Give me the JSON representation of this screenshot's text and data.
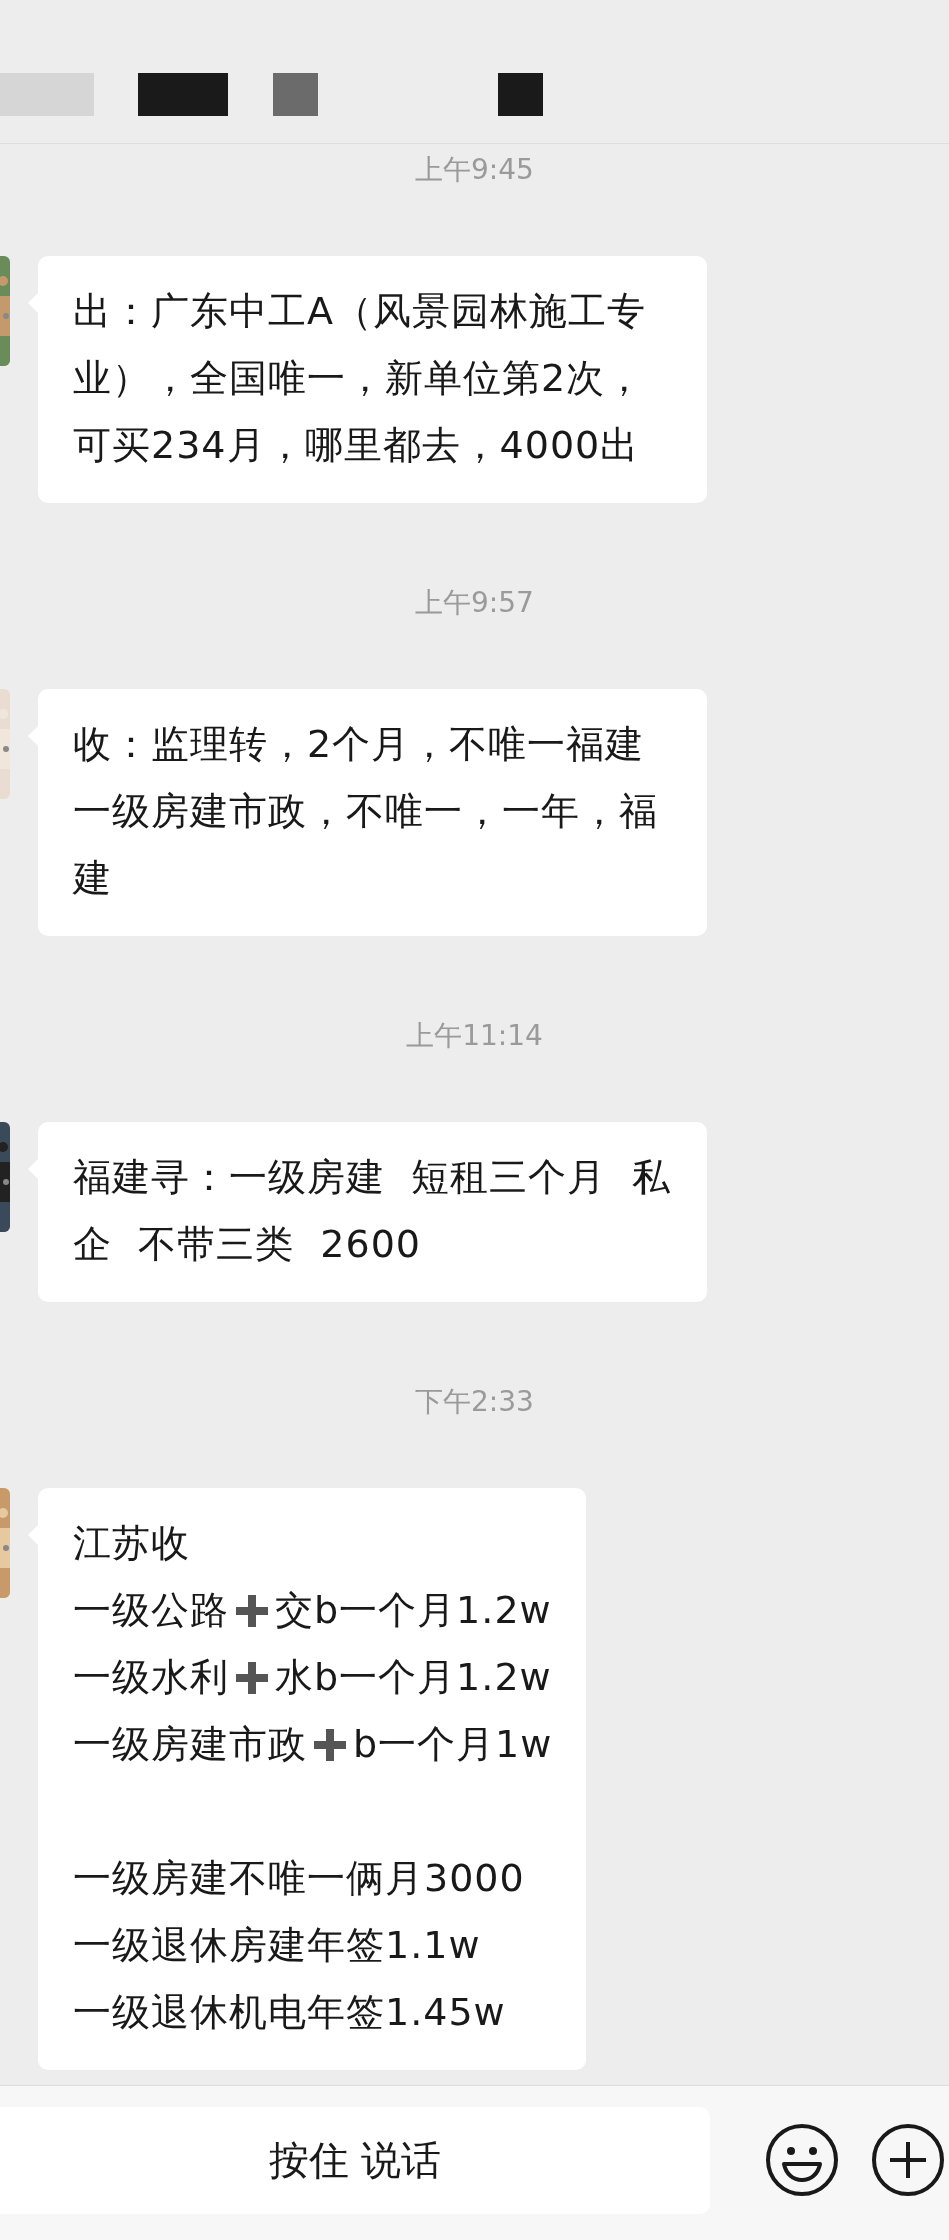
{
  "chat": [
    {
      "kind": "time",
      "text": "上午9:45"
    },
    {
      "kind": "message",
      "blocks": [
        [
          [
            "出：广东中工A（风景园林施工专业），全国唯一，新单位第2次，可买234月，哪里都去，4000出"
          ]
        ]
      ]
    },
    {
      "kind": "time",
      "text": "上午9:57"
    },
    {
      "kind": "message",
      "blocks": [
        [
          [
            "收：监理转，2个月，不唯一福建一级房建市政，不唯一，一年，福建"
          ]
        ]
      ]
    },
    {
      "kind": "time",
      "text": "上午11:14"
    },
    {
      "kind": "message",
      "blocks": [
        [
          [
            "福建寻：一级房建  短租三个月  私企  不带三类  2600"
          ]
        ]
      ]
    },
    {
      "kind": "time",
      "text": "下午2:33"
    },
    {
      "kind": "message",
      "blocks": [
        [
          [
            "江苏收"
          ],
          [
            "一级公路",
            "交b一个月1.2w"
          ],
          [
            "一级水利",
            "水b一个月1.2w"
          ],
          [
            "一级房建市政",
            "b一个月1w"
          ]
        ],
        [
          [
            "一级房建不唯一俩月3000"
          ],
          [
            "一级退休房建年签1.1w"
          ],
          [
            "一级退休机电年签1.45w"
          ]
        ]
      ]
    }
  ],
  "input_bar": {
    "voice_button": "按住 说话"
  }
}
